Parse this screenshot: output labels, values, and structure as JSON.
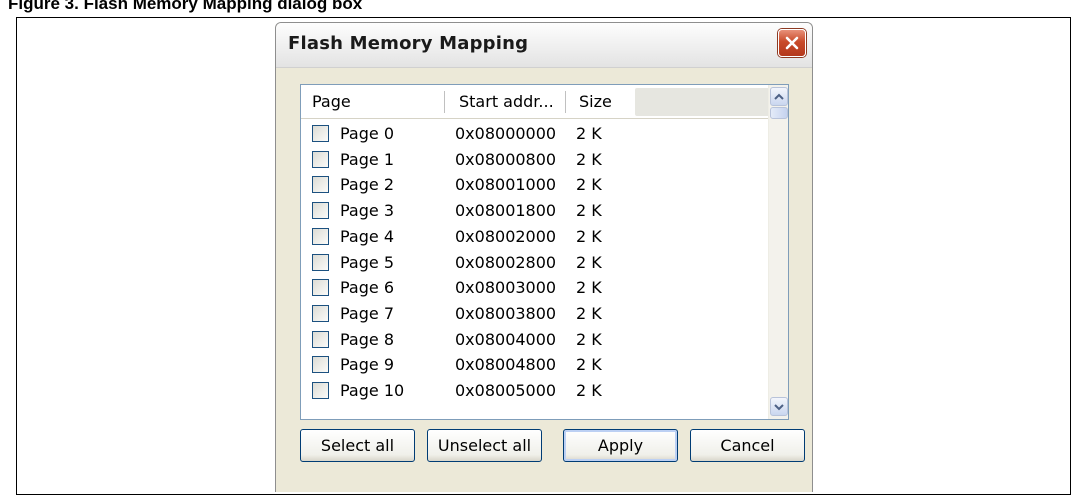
{
  "figure": {
    "caption": "Figure 3.    Flash Memory Mapping dialog box"
  },
  "dialog": {
    "title": "Flash Memory Mapping",
    "close_icon": "close-x-icon",
    "columns": [
      "Page",
      "Start addr...",
      "Size"
    ],
    "rows": [
      {
        "page": "Page 0",
        "start": "0x08000000",
        "size": "2 K",
        "checked": false
      },
      {
        "page": "Page 1",
        "start": "0x08000800",
        "size": "2 K",
        "checked": false
      },
      {
        "page": "Page 2",
        "start": "0x08001000",
        "size": "2 K",
        "checked": false
      },
      {
        "page": "Page 3",
        "start": "0x08001800",
        "size": "2 K",
        "checked": false
      },
      {
        "page": "Page 4",
        "start": "0x08002000",
        "size": "2 K",
        "checked": false
      },
      {
        "page": "Page 5",
        "start": "0x08002800",
        "size": "2 K",
        "checked": false
      },
      {
        "page": "Page 6",
        "start": "0x08003000",
        "size": "2 K",
        "checked": false
      },
      {
        "page": "Page 7",
        "start": "0x08003800",
        "size": "2 K",
        "checked": false
      },
      {
        "page": "Page 8",
        "start": "0x08004000",
        "size": "2 K",
        "checked": false
      },
      {
        "page": "Page 9",
        "start": "0x08004800",
        "size": "2 K",
        "checked": false
      },
      {
        "page": "Page 10",
        "start": "0x08005000",
        "size": "2 K",
        "checked": false
      }
    ],
    "buttons": {
      "select_all": "Select all",
      "unselect_all": "Unselect all",
      "apply": "Apply",
      "cancel": "Cancel"
    }
  },
  "colors": {
    "dialog_bg": "#ece9d8",
    "close_button": "#c94b2a",
    "button_border": "#003c74",
    "listview_border": "#7f9db9"
  }
}
